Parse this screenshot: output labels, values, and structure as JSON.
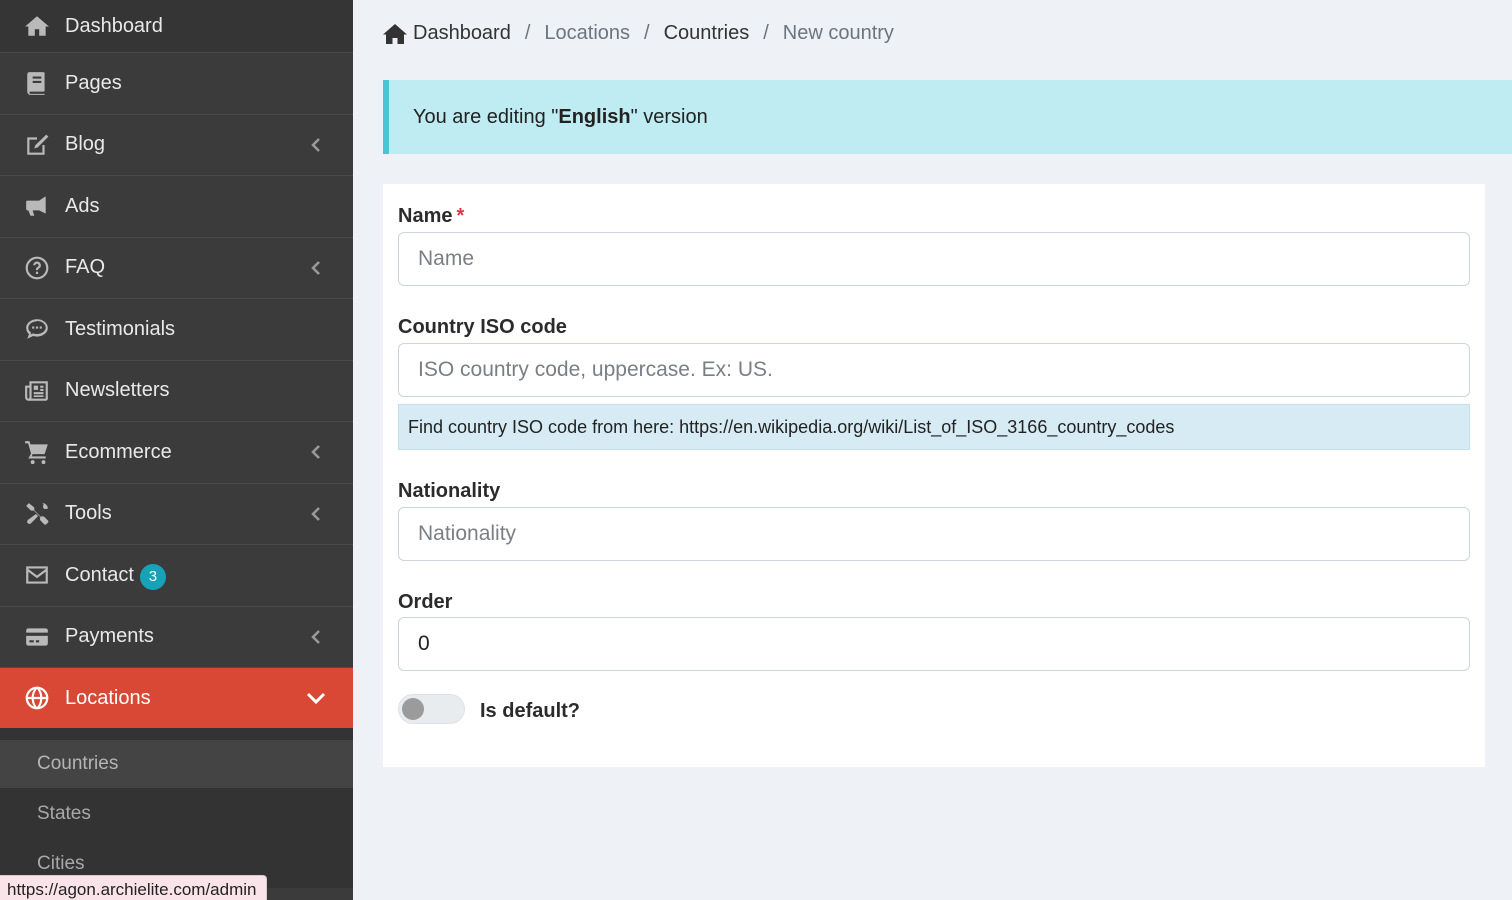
{
  "sidebar": {
    "items": [
      {
        "label": "Dashboard",
        "icon": "home-icon"
      },
      {
        "label": "Pages",
        "icon": "book-icon"
      },
      {
        "label": "Blog",
        "icon": "edit-icon",
        "has_children": true
      },
      {
        "label": "Ads",
        "icon": "bullhorn-icon"
      },
      {
        "label": "FAQ",
        "icon": "question-circle-icon",
        "has_children": true
      },
      {
        "label": "Testimonials",
        "icon": "comment-dots-icon"
      },
      {
        "label": "Newsletters",
        "icon": "newspaper-icon"
      },
      {
        "label": "Ecommerce",
        "icon": "shopping-cart-icon",
        "has_children": true
      },
      {
        "label": "Tools",
        "icon": "tools-icon",
        "has_children": true
      },
      {
        "label": "Contact",
        "icon": "envelope-icon",
        "badge": "3"
      },
      {
        "label": "Payments",
        "icon": "credit-card-icon",
        "has_children": true
      },
      {
        "label": "Locations",
        "icon": "globe-icon",
        "has_children": true,
        "active": true
      }
    ],
    "submenu": [
      {
        "label": "Countries",
        "current": true
      },
      {
        "label": "States"
      },
      {
        "label": "Cities"
      }
    ]
  },
  "status_bar": {
    "url": "https://agon.archielite.com/admin"
  },
  "breadcrumb": {
    "items": [
      "Dashboard",
      "Locations",
      "Countries",
      "New country"
    ],
    "separator": "/"
  },
  "alert": {
    "prefix": "You are editing \"",
    "language": "English",
    "suffix": "\" version"
  },
  "form": {
    "name": {
      "label": "Name",
      "required_mark": "*",
      "placeholder": "Name",
      "value": ""
    },
    "iso_code": {
      "label": "Country ISO code",
      "placeholder": "ISO country code, uppercase. Ex: US.",
      "value": "",
      "help": "Find country ISO code from here: https://en.wikipedia.org/wiki/List_of_ISO_3166_country_codes"
    },
    "nationality": {
      "label": "Nationality",
      "placeholder": "Nationality",
      "value": ""
    },
    "order": {
      "label": "Order",
      "value": "0"
    },
    "is_default": {
      "label": "Is default?",
      "checked": false
    }
  },
  "colors": {
    "sidebar_bg": "#3b3b3b",
    "active_item": "#d94834",
    "badge": "#17a2b8",
    "alert_bg": "#bfecf2",
    "alert_border": "#49c5d6",
    "required": "#dc3545"
  }
}
